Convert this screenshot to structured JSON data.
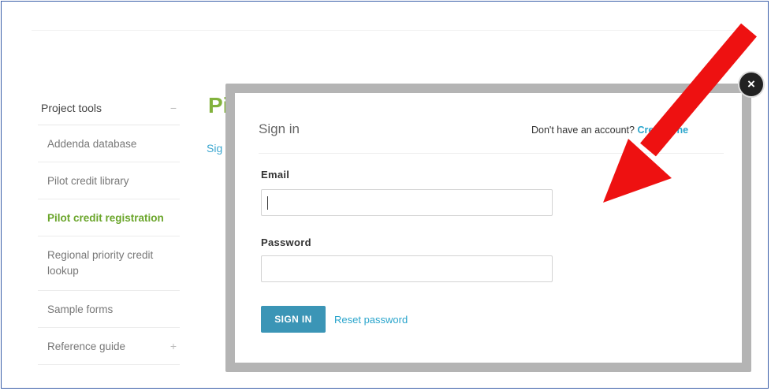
{
  "sidebar": {
    "heading": "Project tools",
    "heading_toggle": "−",
    "items": [
      {
        "label": "Addenda database"
      },
      {
        "label": "Pilot credit library"
      },
      {
        "label": "Pilot credit registration"
      },
      {
        "label": "Regional priority credit lookup"
      },
      {
        "label": "Sample forms"
      },
      {
        "label": "Reference guide",
        "toggle": "+"
      }
    ]
  },
  "background": {
    "title": "Pil",
    "link": "Sig"
  },
  "modal": {
    "title": "Sign in",
    "no_account_text": "Don't have an account?",
    "create_link": "Create one",
    "email_label": "Email",
    "email_value": "",
    "password_label": "Password",
    "password_value": "",
    "sign_in_button": "SIGN IN",
    "reset_link": "Reset password",
    "close_glyph": "×"
  },
  "colors": {
    "accent_green": "#82b23c",
    "link_blue": "#2aa5cc",
    "button_blue": "#3b95b6",
    "arrow_red": "#ee1111"
  }
}
